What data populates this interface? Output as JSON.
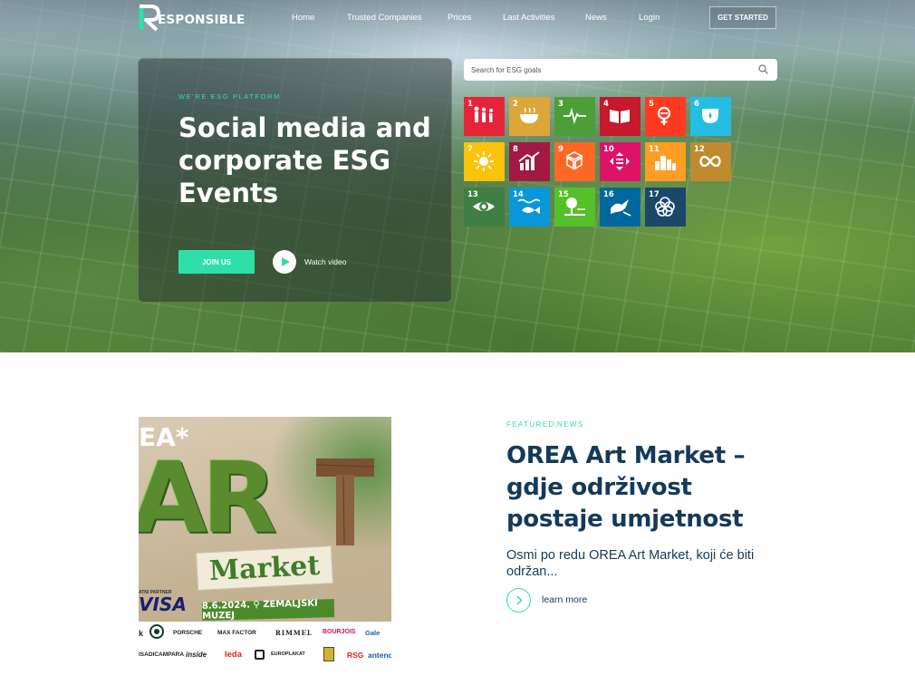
{
  "nav": {
    "logo_text": "ESPONSIBLE",
    "links": [
      "Home",
      "Trusted Companies",
      "Prices",
      "Last Activities",
      "News",
      "Login"
    ],
    "cta": "GET STARTED"
  },
  "hero": {
    "eyebrow": "WE'RE ESG PLATFORM",
    "title": "Social media and corporate ESG Events",
    "join_label": "JOIN US",
    "watch_label": "Watch video"
  },
  "search": {
    "placeholder": "Search for ESG goals"
  },
  "sdg_goals": [
    {
      "number": "1",
      "color": "#e5243b",
      "icon": "people-family-icon"
    },
    {
      "number": "2",
      "color": "#dda63a",
      "icon": "bowl-icon"
    },
    {
      "number": "3",
      "color": "#4c9f38",
      "icon": "heartbeat-icon"
    },
    {
      "number": "4",
      "color": "#c5192d",
      "icon": "book-icon"
    },
    {
      "number": "5",
      "color": "#ff3a21",
      "icon": "gender-equality-icon"
    },
    {
      "number": "6",
      "color": "#26bde2",
      "icon": "water-drop-icon"
    },
    {
      "number": "7",
      "color": "#fcc30b",
      "icon": "sun-icon"
    },
    {
      "number": "8",
      "color": "#a21942",
      "icon": "growth-chart-icon"
    },
    {
      "number": "9",
      "color": "#fd6925",
      "icon": "cubes-icon"
    },
    {
      "number": "10",
      "color": "#dd1367",
      "icon": "equality-arrows-icon"
    },
    {
      "number": "11",
      "color": "#fd9d24",
      "icon": "city-buildings-icon"
    },
    {
      "number": "12",
      "color": "#bf8b2e",
      "icon": "infinity-icon"
    },
    {
      "number": "13",
      "color": "#3f7e44",
      "icon": "eye-earth-icon"
    },
    {
      "number": "14",
      "color": "#0a97d9",
      "icon": "fish-waves-icon"
    },
    {
      "number": "15",
      "color": "#56c02b",
      "icon": "tree-land-icon"
    },
    {
      "number": "16",
      "color": "#00689d",
      "icon": "dove-icon"
    },
    {
      "number": "17",
      "color": "#19486a",
      "icon": "rings-icon"
    }
  ],
  "featured": {
    "categories": [
      "FEATURED",
      "NEWS"
    ],
    "separator": ",",
    "title": "OREA Art Market – gdje održivost postaje umjetnost",
    "excerpt": "Osmi po redu OREA Art Market, koji će biti održan...",
    "learn_more": "learn more",
    "image": {
      "ea_text": "EA*",
      "art_text": "AR",
      "market_text": "Market",
      "partner_label": "ATNI PARTNER",
      "visa_text": "VISA",
      "date_text": "8.6.2024. ⚲ ZEMALJSKI MUZEJ",
      "sponsors": [
        "k",
        "PORSCHE",
        "MAX FACTOR",
        "RIMMEL",
        "BOURJOIS",
        "Gale",
        "ISADICAMPARA",
        "inside",
        "leda",
        "EUROPLAKAT",
        "RSG",
        "antenc"
      ]
    }
  },
  "colors": {
    "accent": "#2ee0a8",
    "navy": "#143a5a"
  }
}
